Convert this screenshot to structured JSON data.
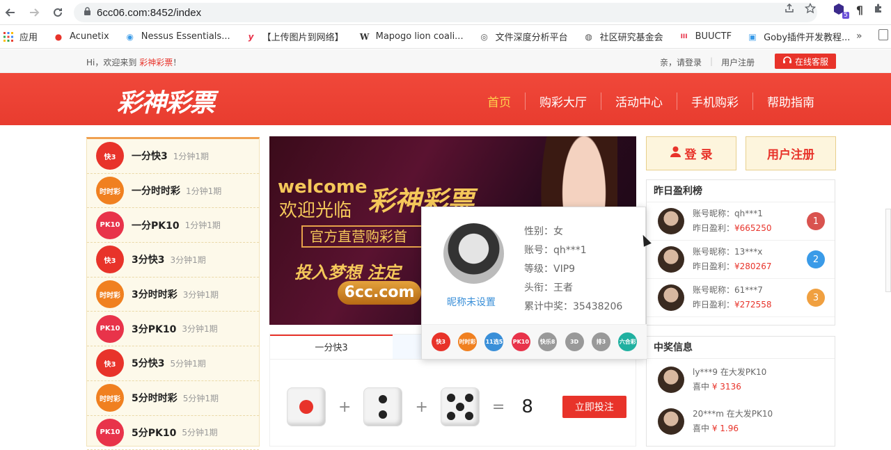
{
  "browser": {
    "url": "6cc06.com:8452/index",
    "bookmarks": [
      {
        "label": "应用",
        "icon": "apps-grid-icon"
      },
      {
        "label": "Acunetix",
        "icon": "acunetix-icon"
      },
      {
        "label": "Nessus Essentials...",
        "icon": "nessus-icon"
      },
      {
        "label": "【上传图片到网络】",
        "icon": "y-icon"
      },
      {
        "label": "Mapogo lion coali...",
        "icon": "wikipedia-icon"
      },
      {
        "label": "文件深度分析平台",
        "icon": "eye-icon"
      },
      {
        "label": "社区研究基金会",
        "icon": "globe-icon"
      },
      {
        "label": "BUUCTF",
        "icon": "buuctf-icon"
      },
      {
        "label": "Goby插件开发教程...",
        "icon": "goby-icon"
      }
    ],
    "ext_badge": "5"
  },
  "topbar": {
    "welcome_prefix": "Hi，欢迎来到",
    "brand": "彩神彩票",
    "welcome_suffix": "！",
    "login": "亲，请登录",
    "register": "用户注册",
    "service": "在线客服"
  },
  "header": {
    "logo": "彩神彩票",
    "nav": [
      "首页",
      "购彩大厅",
      "活动中心",
      "手机购彩",
      "帮助指南"
    ]
  },
  "games": [
    {
      "name": "一分快3",
      "freq": "1分钟1期",
      "icon": "快3",
      "color": "#e8332a"
    },
    {
      "name": "一分时时彩",
      "freq": "1分钟1期",
      "icon": "时时彩",
      "color": "#f08020"
    },
    {
      "name": "一分PK10",
      "freq": "1分钟1期",
      "icon": "PK10",
      "color": "#e8334a"
    },
    {
      "name": "3分快3",
      "freq": "3分钟1期",
      "icon": "快3",
      "color": "#e8332a"
    },
    {
      "name": "3分时时彩",
      "freq": "3分钟1期",
      "icon": "时时彩",
      "color": "#f08020"
    },
    {
      "name": "3分PK10",
      "freq": "3分钟1期",
      "icon": "PK10",
      "color": "#e8334a"
    },
    {
      "name": "5分快3",
      "freq": "5分钟1期",
      "icon": "快3",
      "color": "#e8332a"
    },
    {
      "name": "5分时时彩",
      "freq": "5分钟1期",
      "icon": "时时彩",
      "color": "#f08020"
    },
    {
      "name": "5分PK10",
      "freq": "5分钟1期",
      "icon": "PK10",
      "color": "#e8334a"
    }
  ],
  "banner": {
    "welcome": "welcome",
    "welcome_cn": "欢迎光临",
    "logo": "彩神彩票",
    "slogan": "官方直营购彩首",
    "dream": "投入梦想 注定",
    "site": "6cc.com"
  },
  "lottery": {
    "tab_active": "一分快3",
    "sum": "8",
    "bet_button": "立即投注",
    "plus": "+",
    "equals": "="
  },
  "auth": {
    "login": "登 录",
    "register": "用户注册"
  },
  "ranking": {
    "title": "昨日盈利榜",
    "nick_label": "账号昵称：",
    "profit_label": "昨日盈利：",
    "rows": [
      {
        "nick": "qh***1",
        "amount": "¥665250",
        "rank": "1",
        "badge_color": "#d9534f"
      },
      {
        "nick": "13***x",
        "amount": "¥280267",
        "rank": "2",
        "badge_color": "#3a9be8"
      },
      {
        "nick": "61***7",
        "amount": "¥272558",
        "rank": "3",
        "badge_color": "#f0a040"
      }
    ]
  },
  "winners": {
    "title": "中奖信息",
    "rows": [
      {
        "line": "ly***9 在大发PK10",
        "prefix": "喜中",
        "amount": "¥ 3136"
      },
      {
        "line": "20***m 在大发PK10",
        "prefix": "喜中",
        "amount": "¥ 1.96"
      }
    ]
  },
  "popup": {
    "nickname": "昵称未设置",
    "gender": "性别：女",
    "account": "账号：qh***1",
    "level": "等级：VIP9",
    "title": "头衔：王者",
    "total": "累计中奖：35438206",
    "icons": [
      {
        "label": "快3",
        "color": "#e8332a"
      },
      {
        "label": "时时彩",
        "color": "#f08020"
      },
      {
        "label": "11选5",
        "color": "#3a8fd8"
      },
      {
        "label": "PK10",
        "color": "#e8334a"
      },
      {
        "label": "快乐8",
        "color": "#999999"
      },
      {
        "label": "3D",
        "color": "#999999"
      },
      {
        "label": "排3",
        "color": "#999999"
      },
      {
        "label": "六合彩",
        "color": "#20b0a0"
      }
    ]
  }
}
